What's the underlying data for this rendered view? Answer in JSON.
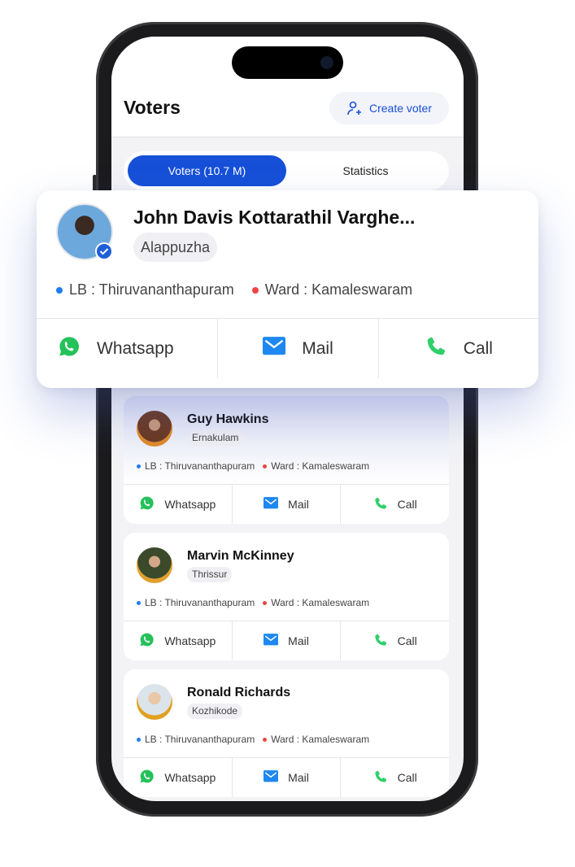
{
  "header": {
    "title": "Voters",
    "create_label": "Create voter"
  },
  "tabs": [
    {
      "label": "Voters  (10.7 M)",
      "active": true
    },
    {
      "label": "Statistics",
      "active": false
    }
  ],
  "featured": {
    "name": "John Davis Kottarathil Varghe...",
    "district": "Alappuzha",
    "lb": "LB : Thiruvananthapuram",
    "ward": "Ward : Kamaleswaram",
    "verified": true
  },
  "actions": {
    "whatsapp": "Whatsapp",
    "mail": "Mail",
    "call": "Call"
  },
  "voters": [
    {
      "name": "Guy Hawkins",
      "district": "Ernakulam",
      "lb": "LB : Thiruvananthapuram",
      "ward": "Ward : Kamaleswaram"
    },
    {
      "name": "Marvin McKinney",
      "district": "Thrissur",
      "lb": "LB : Thiruvananthapuram",
      "ward": "Ward : Kamaleswaram"
    },
    {
      "name": "Ronald Richards",
      "district": "Kozhikode",
      "lb": "LB : Thiruvananthapuram",
      "ward": "Ward : Kamaleswaram"
    }
  ],
  "colors": {
    "accent": "#1650d8",
    "lb_dot": "#1e7ef0",
    "ward_dot": "#ef4444",
    "whatsapp": "#25c15a",
    "mail": "#1e88f0",
    "call": "#2fcf6a"
  }
}
